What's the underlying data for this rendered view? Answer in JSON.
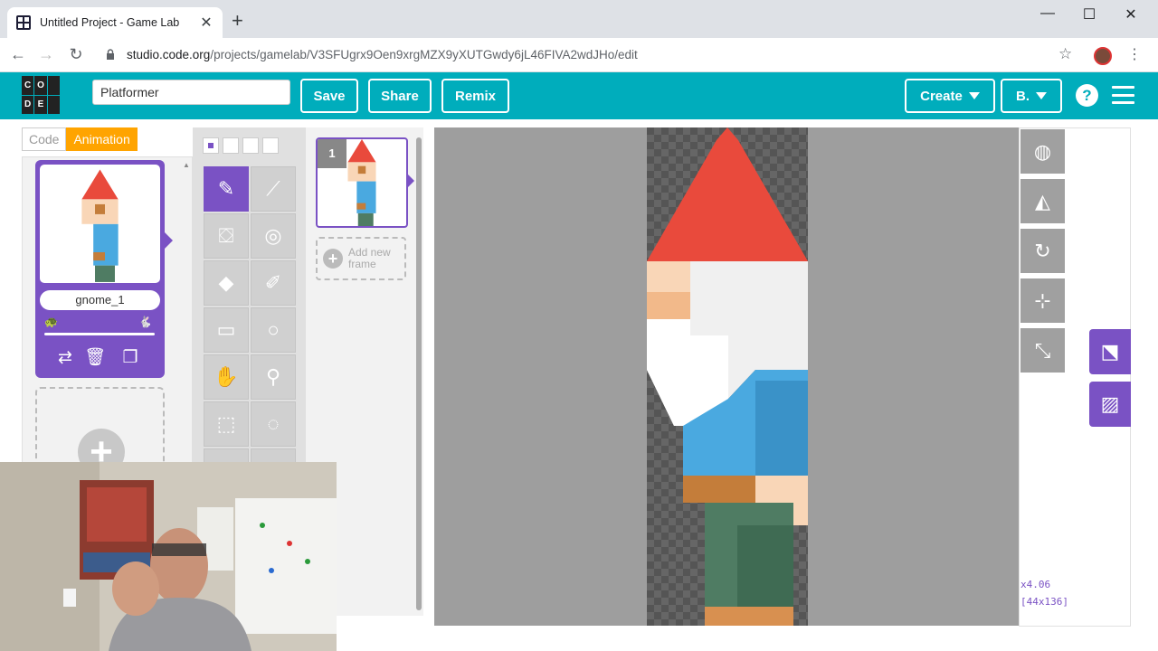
{
  "browser": {
    "tab_title": "Untitled Project - Game Lab",
    "tab_close": "✕",
    "new_tab": "+",
    "url_host": "studio.code.org",
    "url_path": "/projects/gamelab/V3SFUgrx9Oen9xrgMZX9yXUTGwdy6jL46FIVA2wdJHo/edit",
    "window_controls": [
      "—",
      "☐",
      "✕"
    ]
  },
  "header": {
    "logo_letters": [
      "C",
      "O",
      "",
      "D",
      "E",
      ""
    ],
    "project_name": "Platformer",
    "save_label": "Save",
    "share_label": "Share",
    "remix_label": "Remix",
    "create_label": "Create",
    "account_label": "B.",
    "help_label": "?"
  },
  "modes": {
    "code_label": "Code",
    "animation_label": "Animation",
    "active": "Animation"
  },
  "animations": [
    {
      "name": "gnome_1"
    }
  ],
  "frames": {
    "items": [
      {
        "number": "1"
      }
    ],
    "add_label": "Add new frame"
  },
  "canvas": {
    "zoom": "x4.06",
    "dimensions": "[44x136]"
  },
  "icons": {
    "toolbox": [
      "pencil-icon",
      "line-icon",
      "paint-bucket-icon",
      "recolor-icon",
      "eraser-icon",
      "brush-icon",
      "rectangle-icon",
      "circle-icon",
      "hand-icon",
      "eyedropper-icon",
      "rect-select-icon",
      "lasso-icon"
    ],
    "right_tools": [
      "onion-skin-icon",
      "flip-icon",
      "rotate-icon",
      "center-icon",
      "resize-icon",
      "fit-icon",
      "background-image-icon"
    ]
  },
  "colors": {
    "brand_teal": "#00adbc",
    "accent_purple": "#7a52c4",
    "animation_tab": "#ffa400"
  }
}
